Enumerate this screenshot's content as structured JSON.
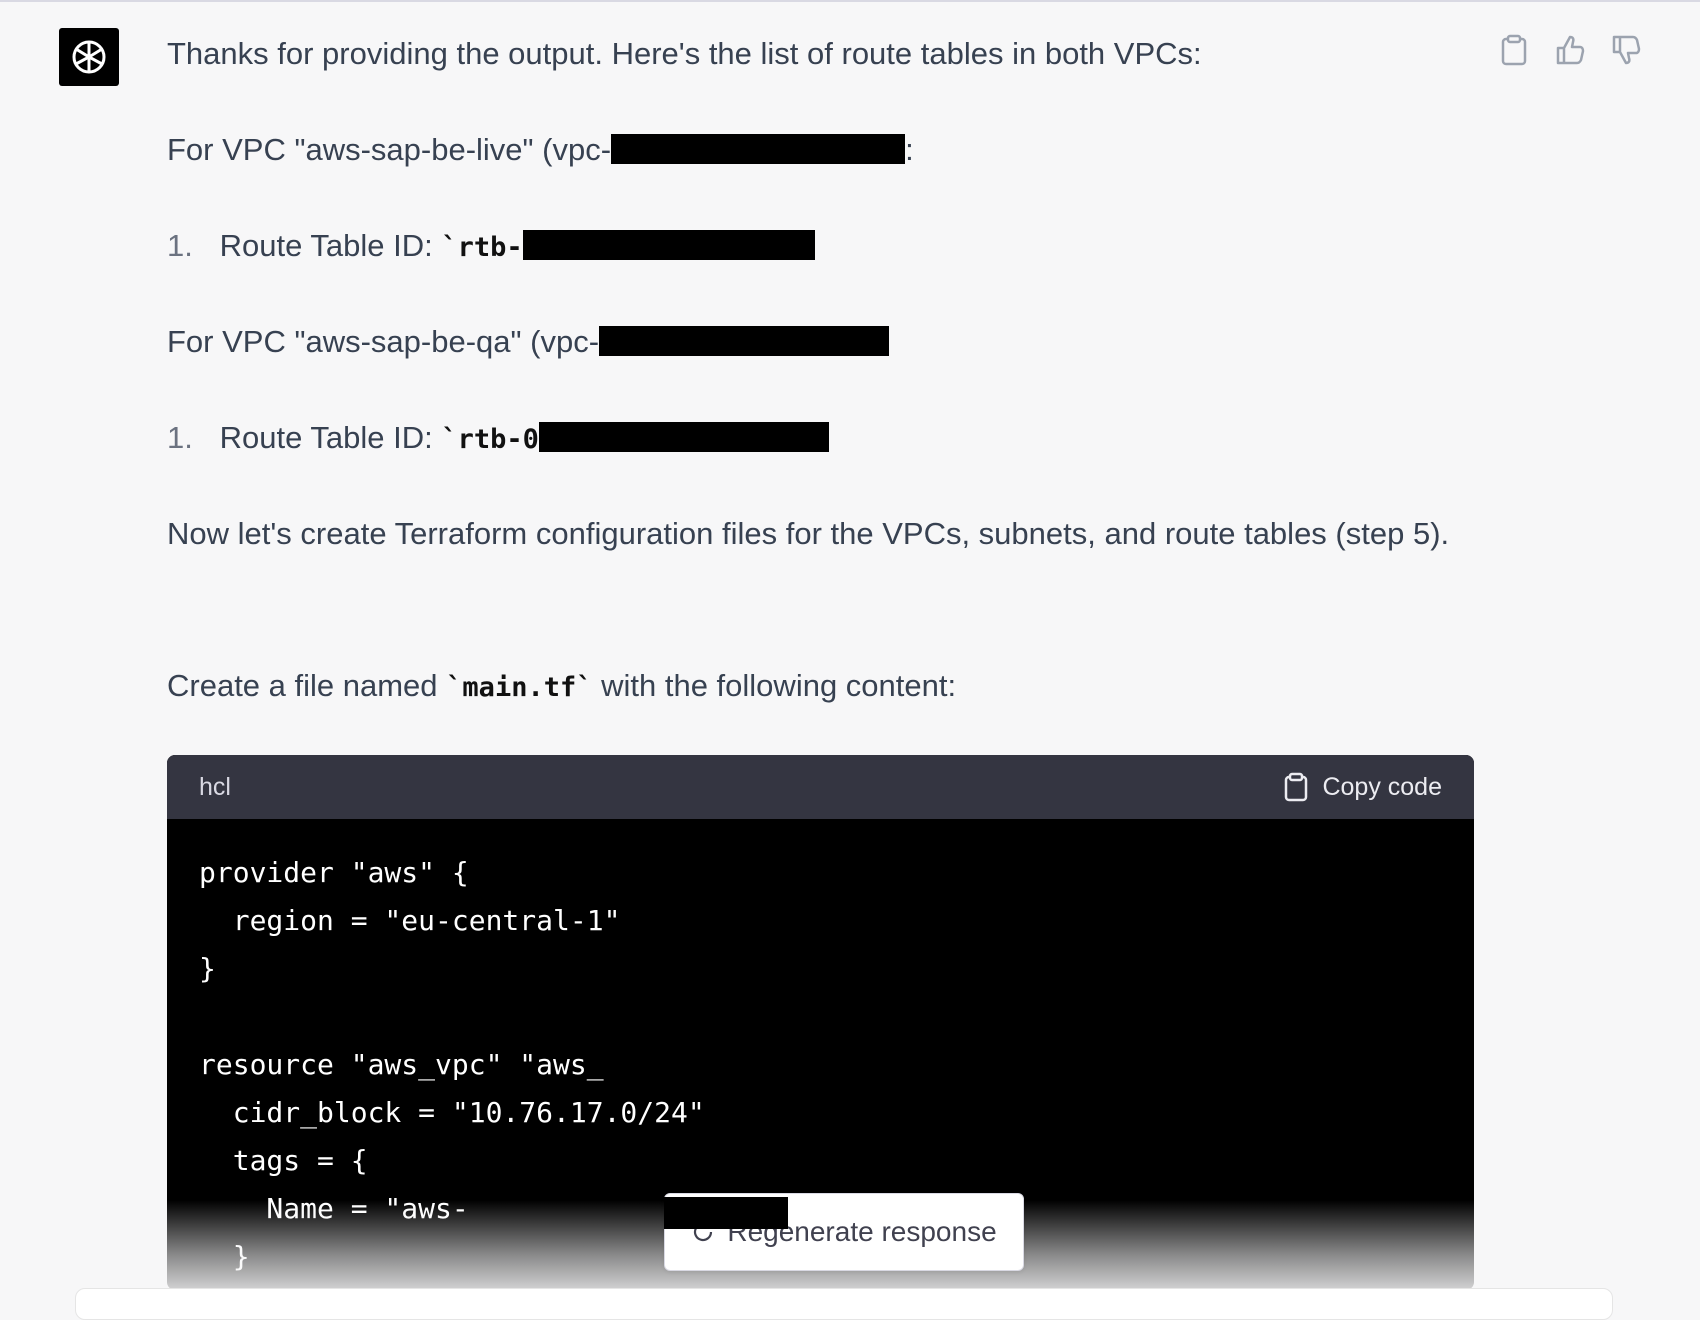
{
  "message": {
    "intro": "Thanks for providing the output. Here's the list of route tables in both VPCs:",
    "vpc1_label": "For VPC \"aws-sap-be-live\" (vpc-",
    "vpc1_suffix": ":",
    "list1_num": "1.",
    "list1_label": "Route Table ID:",
    "list1_code": "`rtb-",
    "vpc2_label": "For VPC \"aws-sap-be-qa\" (vpc-",
    "list2_num": "1.",
    "list2_label": "Route Table ID:",
    "list2_code": "`rtb-0",
    "next_step": "Now let's create Terraform configuration files for the VPCs, subnets, and route tables (step 5).",
    "create_prefix": "Create a file named",
    "create_code": "`main.tf`",
    "create_suffix": "with the following content:"
  },
  "code_block": {
    "language": "hcl",
    "copy_label": "Copy code",
    "content": "provider \"aws\" {\n  region = \"eu-central-1\"\n}\n\nresource \"aws_vpc\" \"aws_\n  cidr_block = \"10.76.17.0/24\"\n  tags = {\n    Name = \"aws-\n  }"
  },
  "footer": {
    "regenerate_label": "Regenerate response"
  },
  "icons": {
    "avatar": "openai-logo-icon",
    "copy": "clipboard-icon",
    "like": "thumbs-up-icon",
    "dislike": "thumbs-down-icon",
    "regenerate": "refresh-icon"
  }
}
